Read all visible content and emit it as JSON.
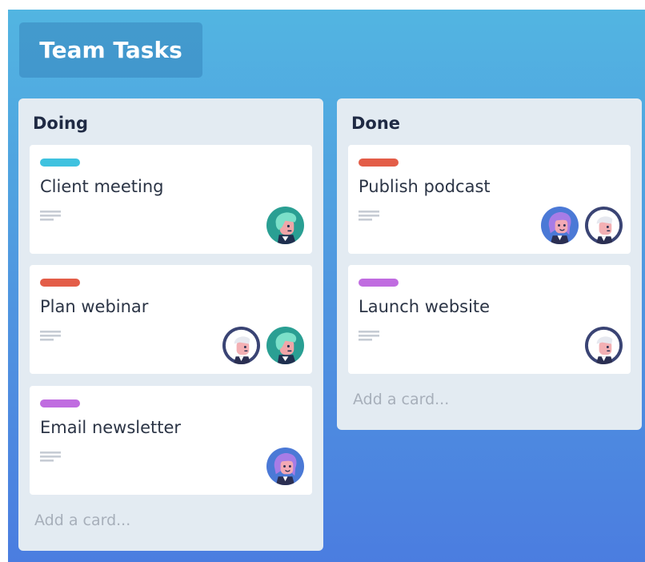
{
  "board": {
    "title": "Team Tasks",
    "colors": {
      "background_top": "#52b5e1",
      "background_bottom": "#4b7de0",
      "list_background": "#e3ebf2",
      "card_background": "#ffffff"
    }
  },
  "lists": [
    {
      "title": "Doing",
      "add_card_label": "Add a card...",
      "cards": [
        {
          "title": "Client meeting",
          "label_color": "#3fc2df",
          "members": [
            "teal-avatar"
          ]
        },
        {
          "title": "Plan webinar",
          "label_color": "#e35d48",
          "members": [
            "navy-avatar",
            "teal-avatar"
          ]
        },
        {
          "title": "Email newsletter",
          "label_color": "#c06ce0",
          "members": [
            "purple-avatar"
          ]
        }
      ]
    },
    {
      "title": "Done",
      "add_card_label": "Add a card...",
      "cards": [
        {
          "title": "Publish podcast",
          "label_color": "#e35d48",
          "members": [
            "purple-avatar",
            "navy-avatar"
          ]
        },
        {
          "title": "Launch website",
          "label_color": "#c06ce0",
          "members": [
            "navy-avatar"
          ]
        }
      ]
    }
  ]
}
